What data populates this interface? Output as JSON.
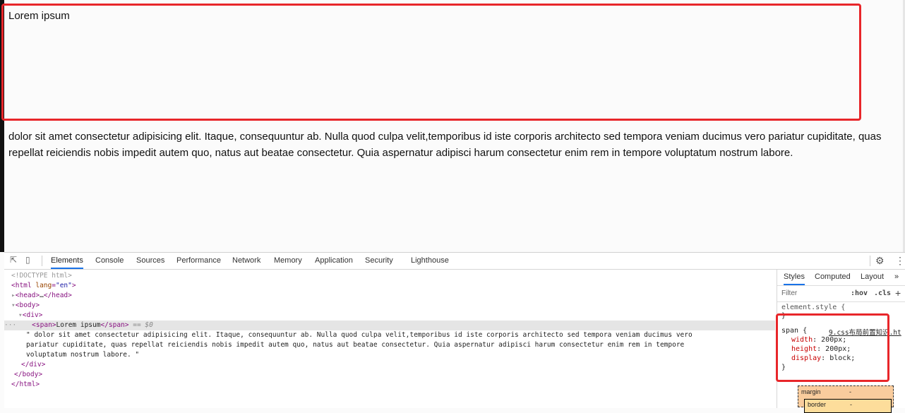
{
  "page": {
    "span_text": "Lorem ipsum",
    "paragraph": "dolor sit amet consectetur adipisicing elit. Itaque, consequuntur ab. Nulla quod culpa velit,temporibus id iste corporis architecto sed tempora veniam ducimus vero pariatur cupiditate, quas repellat reiciendis nobis impedit autem quo, natus aut beatae consectetur. Quia aspernatur adipisci harum consectetur enim rem in tempore voluptatum nostrum labore."
  },
  "devtools": {
    "tabs": [
      "Elements",
      "Console",
      "Sources",
      "Performance",
      "Network",
      "Memory",
      "Application",
      "Security",
      "Lighthouse"
    ],
    "active_tab": "Elements",
    "dom": {
      "doctype": "<!DOCTYPE html>",
      "html_open_tag": "html",
      "lang_attr": "lang",
      "lang_value": "\"en\"",
      "head": "head",
      "head_ellipsis": "…",
      "body": "body",
      "div": "div",
      "span_tag": "span",
      "span_content": "Lorem ipsum",
      "selected_marker": "== $0",
      "text_node_line1": "\" dolor sit amet consectetur adipisicing elit. Itaque, consequuntur ab. Nulla quod culpa velit,temporibus id iste corporis architecto sed tempora veniam ducimus vero",
      "text_node_line2": "pariatur cupiditate, quas repellat reiciendis nobis impedit autem quo, natus aut beatae consectetur. Quia aspernatur adipisci harum consectetur enim rem in tempore",
      "text_node_line3": "voluptatum nostrum labore. \"",
      "div_close": "div",
      "body_close": "body",
      "html_close": "html"
    },
    "styles": {
      "tabs": [
        "Styles",
        "Computed",
        "Layout",
        "»"
      ],
      "filter_placeholder": "Filter",
      "hov": ":hov",
      "cls": ".cls",
      "plus": "+",
      "element_style": "element.style {",
      "element_style_close": "}",
      "rule_selector": "span {",
      "rule_source": "9.css布局前置知识.ht",
      "declarations": [
        {
          "prop": "width",
          "value": "200px;"
        },
        {
          "prop": "height",
          "value": "200px;"
        },
        {
          "prop": "display",
          "value": "block;"
        }
      ],
      "rule_close": "}",
      "box_margin_label": "margin",
      "box_margin_value": "-",
      "box_border_label": "border",
      "box_border_value": "-"
    }
  },
  "colors": {
    "highlight_red": "#e8262a",
    "active_tab_blue": "#1a73e8"
  }
}
